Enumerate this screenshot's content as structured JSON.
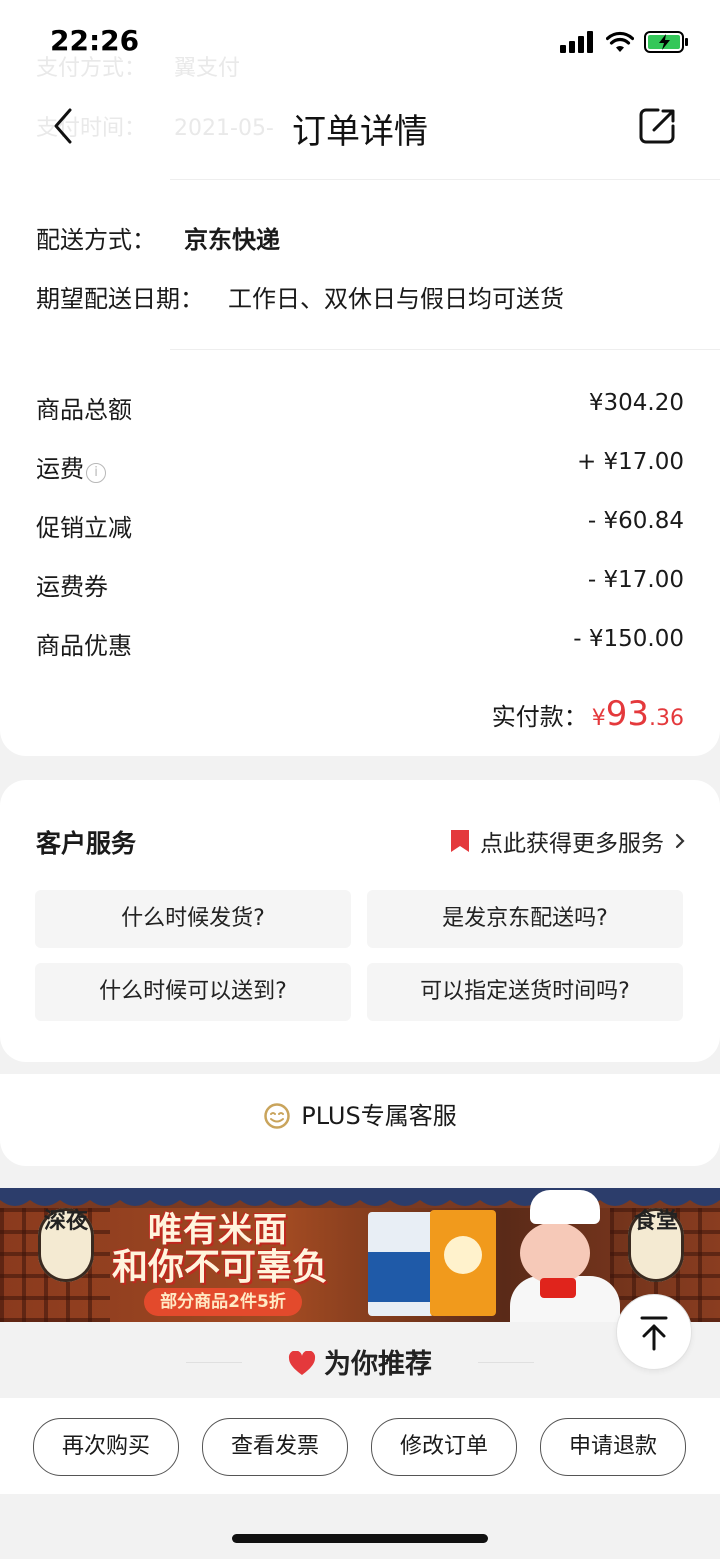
{
  "status_bar": {
    "time": "22:26"
  },
  "ghost_rows": [
    {
      "label": "支付方式：",
      "value": "翼支付"
    },
    {
      "label": "支付时间：",
      "value": "2021-05-"
    }
  ],
  "header": {
    "title": "订单详情"
  },
  "shipping": {
    "method_label": "配送方式：",
    "method_value": "京东快递",
    "date_label": "期望配送日期：",
    "date_value": "工作日、双休日与假日均可送货"
  },
  "amounts": {
    "rows": [
      {
        "label": "商品总额",
        "value": "¥304.20"
      },
      {
        "label": "运费",
        "value": "+ ¥17.00"
      },
      {
        "label": "促销立减",
        "value": "- ¥60.84"
      },
      {
        "label": "运费券",
        "value": "- ¥17.00"
      },
      {
        "label": "商品优惠",
        "value": "- ¥150.00"
      }
    ],
    "paid_label": "实付款：",
    "paid_currency": "¥",
    "paid_int": "93",
    "paid_dec": ".36"
  },
  "service": {
    "title": "客户服务",
    "more_label": "点此获得更多服务",
    "questions": [
      "什么时候发货?",
      "是发京东配送吗?",
      "什么时候可以送到?",
      "可以指定送货时间吗?"
    ]
  },
  "plus": {
    "label": "PLUS专属客服"
  },
  "banner": {
    "lantern_left": "深夜",
    "lantern_right": "食堂",
    "title_line1": "唯有米面",
    "title_line2": "和你不可辜负",
    "promo": "部分商品2件5折"
  },
  "recommend": {
    "title": "为你推荐"
  },
  "actions": [
    "再次购买",
    "查看发票",
    "修改订单",
    "申请退款"
  ],
  "colors": {
    "accent": "#e4393c"
  }
}
